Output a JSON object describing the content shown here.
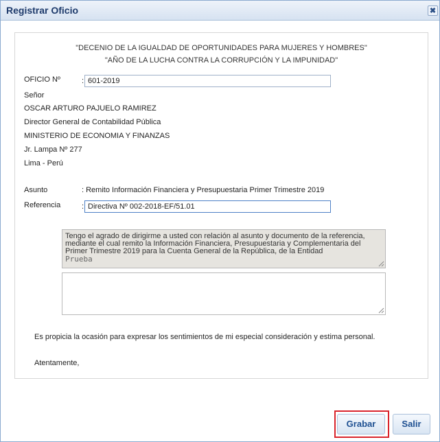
{
  "window": {
    "title": "Registrar Oficio",
    "close_symbol": "✖"
  },
  "header": {
    "line1": "\"DECENIO DE LA IGUALDAD DE OPORTUNIDADES PARA MUJERES Y HOMBRES\"",
    "line2": "\"AÑO DE LA LUCHA CONTRA LA CORRUPCIÓN Y LA IMPUNIDAD\""
  },
  "oficio": {
    "label": "OFICIO Nº",
    "colon": ":",
    "value": "601-2019"
  },
  "recipient": {
    "salutation": "Señor",
    "name": "OSCAR ARTURO PAJUELO RAMIREZ",
    "position": "Director General de Contabilidad Pública",
    "ministry": "MINISTERIO DE ECONOMIA Y FINANZAS",
    "address": "Jr. Lampa Nº 277",
    "city": "Lima - Perú"
  },
  "asunto": {
    "label": "Asunto",
    "value": ": Remito Información Financiera y Presupuestaria  Primer Trimestre 2019"
  },
  "referencia": {
    "label": "Referencia",
    "colon": ":",
    "value": "Directiva Nº 002-2018-EF/51.01"
  },
  "body": {
    "paragraph": "Tengo el agrado de dirigirme a usted con relación al asunto y documento de la referencia, mediante el cual remito la Información Financiera, Presupuestaria y Complementaria del Primer Trimestre 2019 para la Cuenta General de la República, de la Entidad",
    "entity": "Prueba",
    "additional_text": ""
  },
  "closing": {
    "sentence": "Es propicia la ocasión para expresar los sentimientos de mi especial consideración y estima personal.",
    "signoff": "Atentamente,"
  },
  "buttons": {
    "save": "Grabar",
    "exit": "Salir"
  },
  "colors": {
    "title": "#1d3a6b",
    "button_text": "#1d4f91",
    "highlight": "#d9232b"
  }
}
